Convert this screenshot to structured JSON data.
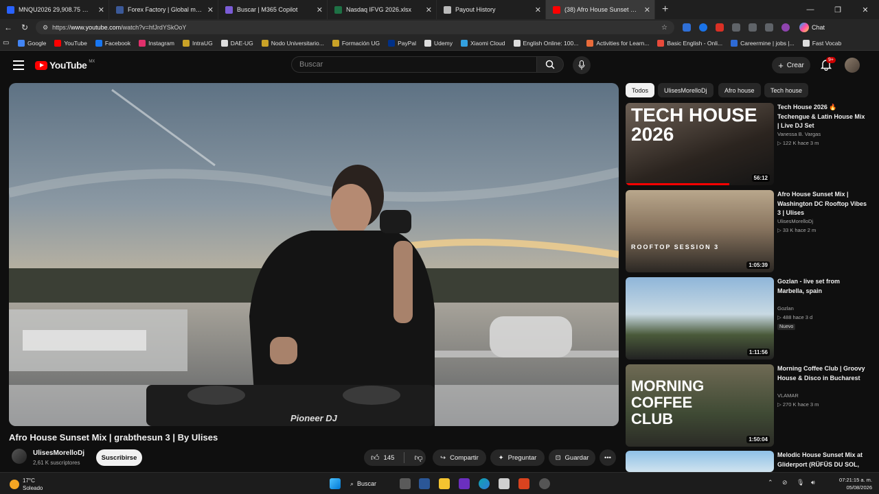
{
  "browser": {
    "tabs": [
      {
        "title": "MNQU2026 29,908.75 ▲ +0.15% |",
        "color": "#2962ff",
        "active": false
      },
      {
        "title": "Forex Factory | Global markets for",
        "color": "#3b5998",
        "active": false
      },
      {
        "title": "Buscar | M365 Copilot",
        "color": "#7b5cd6",
        "active": false
      },
      {
        "title": "Nasdaq IFVG 2026.xlsx",
        "color": "#1e7145",
        "active": false
      },
      {
        "title": "Payout History",
        "color": "#bbbbbb",
        "active": false
      },
      {
        "title": "(38) Afro House Sunset Mix | ✕",
        "color": "#ff0000",
        "active": true
      }
    ],
    "new_tab": "+",
    "url_prefix": "https://",
    "url_host": "www.youtube.com",
    "url_path": "/watch?v=hfJrdYSkOoY",
    "copilot_label": "Chat",
    "bookmarks": [
      {
        "label": "Google",
        "color": "#4285f4"
      },
      {
        "label": "YouTube",
        "color": "#ff0000"
      },
      {
        "label": "Facebook",
        "color": "#1877f2"
      },
      {
        "label": "Instagram",
        "color": "#e1306c"
      },
      {
        "label": "IntraUG",
        "color": "#c9a227"
      },
      {
        "label": "DAE-UG",
        "color": "#dddddd"
      },
      {
        "label": "Nodo Universitario...",
        "color": "#c9a227"
      },
      {
        "label": "Formación UG",
        "color": "#c9a227"
      },
      {
        "label": "PayPal",
        "color": "#003087"
      },
      {
        "label": "Udemy",
        "color": "#dddddd"
      },
      {
        "label": "Xiaomi Cloud",
        "color": "#33a1e0"
      },
      {
        "label": "English Online: 100...",
        "color": "#dddddd"
      },
      {
        "label": "Activities for Learn...",
        "color": "#e86b3a"
      },
      {
        "label": "Basic English - Onli...",
        "color": "#e84a3a"
      },
      {
        "label": "Careermine | jobs |...",
        "color": "#2e6bd6"
      },
      {
        "label": "Fast Vocab",
        "color": "#dddddd"
      }
    ]
  },
  "youtube": {
    "logo_text": "YouTube",
    "country": "MX",
    "search_placeholder": "Buscar",
    "create_label": "Crear",
    "notif_count": "9+",
    "video_title": "Afro House Sunset Mix | grabthesun 3 | By Ulises",
    "channel_name": "UlisesMorelloDj",
    "subscribers": "2,61 K suscriptores",
    "subscribe_label": "Suscribirse",
    "like_count": "145",
    "share_label": "Compartir",
    "ask_label": "Preguntar",
    "save_label": "Guardar",
    "chips": [
      "Todos",
      "UlisesMorelloDj",
      "Afro house",
      "Tech house"
    ],
    "recommendations": [
      {
        "title": "Tech House 2026 🔥 Techengue & Latin House Mix | Live DJ Set",
        "channel": "Vanessa B. Vargas",
        "meta": "▷ 122 K  hace 3 m",
        "duration": "56:12",
        "badge": "",
        "thumb_text": "TECH HOUSE 2026"
      },
      {
        "title": "Afro House Sunset Mix | Washington DC Rooftop Vibes 3 | Ulises",
        "channel": "UlisesMorelloDj",
        "meta": "▷ 33 K  hace 2 m",
        "duration": "1:05:39",
        "badge": "",
        "thumb_text": "ROOFTOP SESSION 3"
      },
      {
        "title": "Gozlan - live set from Marbella, spain",
        "channel": "Gozlan",
        "meta": "▷ 488  hace 3 d",
        "duration": "1:11:56",
        "badge": "Nuevo",
        "thumb_text": ""
      },
      {
        "title": "Morning Coffee Club | Groovy House & Disco in Bucharest",
        "channel": "VLAMAR",
        "meta": "▷ 270 K  hace 3 m",
        "duration": "1:50:04",
        "badge": "",
        "thumb_text": "MORNING COFFEE CLUB"
      },
      {
        "title": "Melodic House Sunset Mix at Gliderport (RÜFÜS DU SOL,",
        "channel": "",
        "meta": "",
        "duration": "",
        "badge": "",
        "thumb_text": ""
      }
    ]
  },
  "taskbar": {
    "temp": "17°C",
    "condition": "Soleado",
    "search_label": "Buscar",
    "time": "07:21:15 a. m.",
    "date": "05/08/2026"
  }
}
